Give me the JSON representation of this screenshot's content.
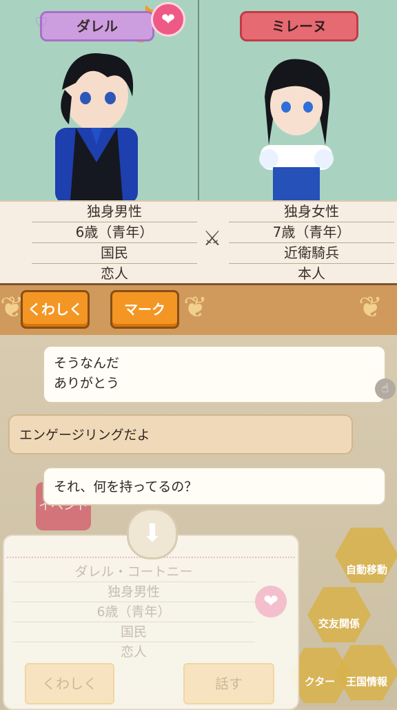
{
  "left_character": {
    "name": "ダレル",
    "status": "独身男性",
    "age": "6歳（青年）",
    "class": "国民",
    "relation": "恋人"
  },
  "right_character": {
    "name": "ミレーヌ",
    "status": "独身女性",
    "age": "7歳（青年）",
    "class": "近衛騎兵",
    "relation": "本人"
  },
  "versus_symbol": "⚔",
  "buttons": {
    "details": "くわしく",
    "mark": "マーク"
  },
  "dialogue": {
    "line1": "そうなんだ",
    "line2": "ありがとう",
    "line3": "エンゲージリングだよ",
    "line4": "それ、何を持ってるの？"
  },
  "hex_menu": {
    "auto_move": "自動移動",
    "relations": "交友関係",
    "character": "クター",
    "kingdom_info": "王国情報"
  },
  "event_badge": "イベント",
  "panel": {
    "full_name": "ダレル・コートニー",
    "status": "独身男性",
    "age": "6歳（青年）",
    "class": "国民",
    "relation": "恋人",
    "details_button": "くわしく",
    "talk_button": "話す"
  },
  "colors": {
    "accent_orange": "#f39624",
    "bar_tan": "#cf9a5b",
    "portrait_bg": "#a9d3c0"
  }
}
